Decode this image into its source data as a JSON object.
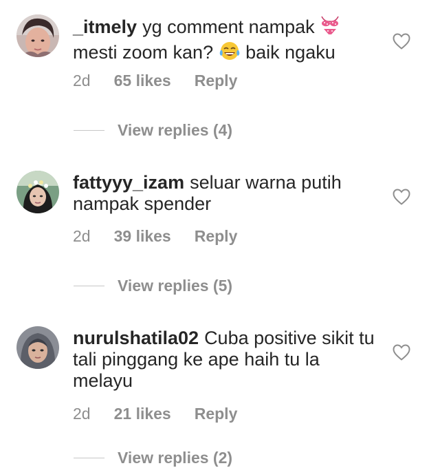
{
  "comments": [
    {
      "username": "_itmely",
      "text_line1": "yg comment nampak",
      "emoji1_icon": "bikini-emoji",
      "text_line2a": "mesti zoom kan?",
      "emoji2_icon": "tears-of-joy-emoji",
      "text_line2b": "baik ngaku",
      "time": "2d",
      "likes": "65 likes",
      "reply": "Reply",
      "view_replies": "View replies (4)"
    },
    {
      "username": "fattyyy_izam",
      "text": "seluar warna putih nampak spender",
      "time": "2d",
      "likes": "39 likes",
      "reply": "Reply",
      "view_replies": "View replies (5)"
    },
    {
      "username": "nurulshatila02",
      "text": "Cuba positive sikit tu tali pinggang ke ape haih tu la melayu",
      "time": "2d",
      "likes": "21 likes",
      "reply": "Reply",
      "view_replies": "View replies (2)"
    }
  ],
  "icons": {
    "like": "heart-outline-icon"
  },
  "colors": {
    "text": "#262626",
    "secondary": "#8e8e8e",
    "divider": "#c7c7c7"
  }
}
